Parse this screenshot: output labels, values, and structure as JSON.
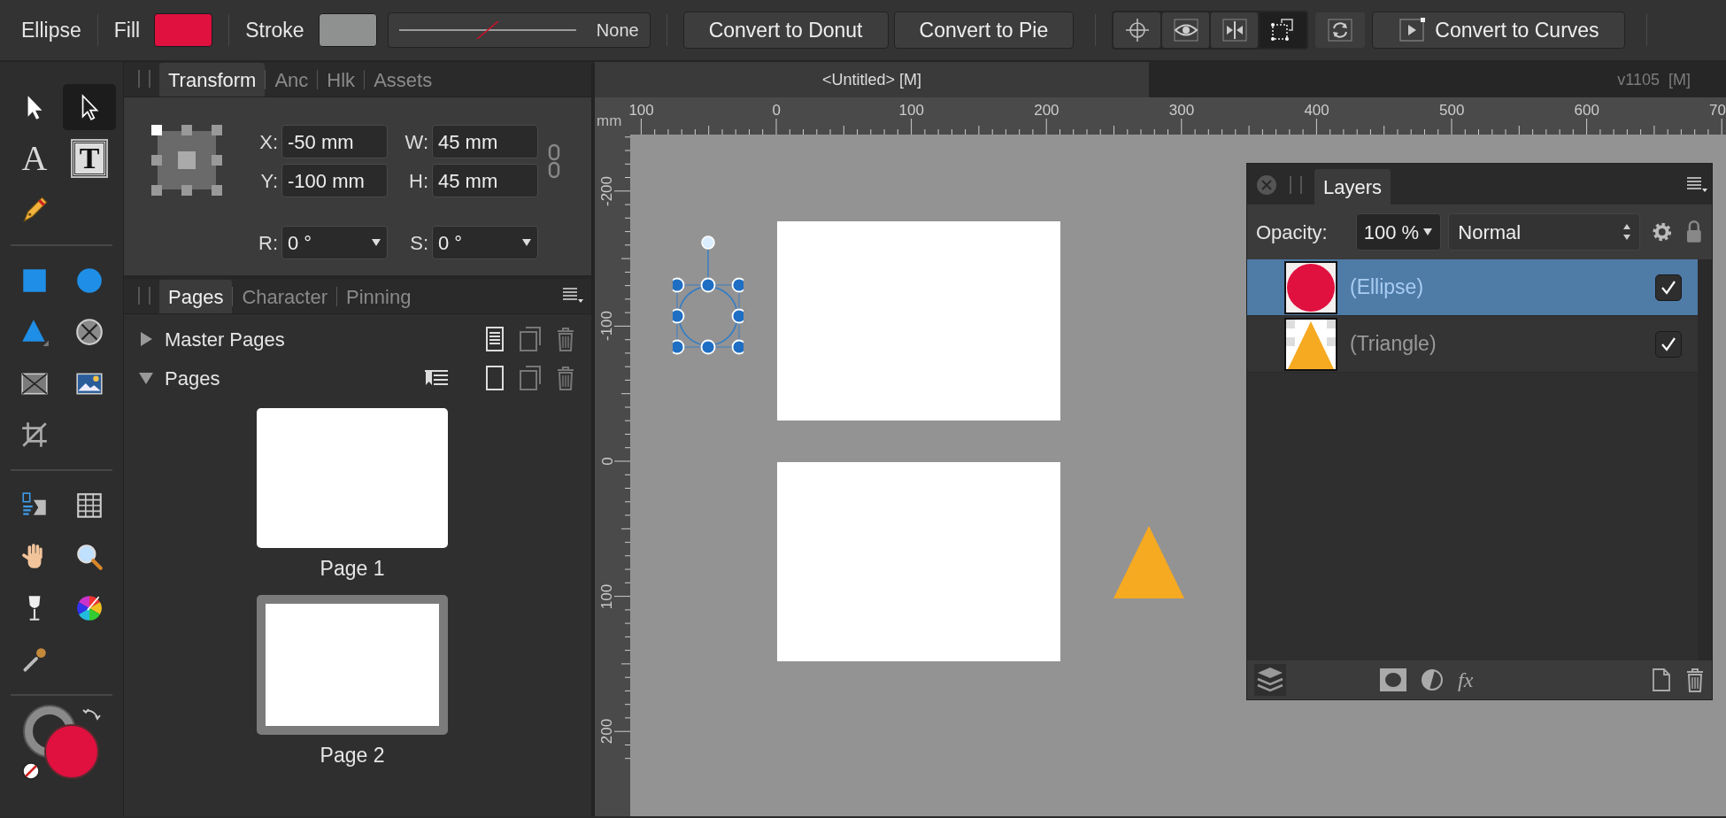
{
  "toolbar": {
    "context": "Ellipse",
    "fill": {
      "label": "Fill",
      "color": "#e0103f"
    },
    "stroke": {
      "label": "Stroke",
      "color": "#8f9191"
    },
    "stroke_width": "None",
    "buttons": [
      "Convert to Donut",
      "Convert to Pie"
    ],
    "toggles": [
      {
        "selected": false
      },
      {
        "selected": false
      },
      {
        "selected": false
      },
      {
        "selected": true
      }
    ],
    "curves_button": "Convert to Curves"
  },
  "tool_groups": [
    [
      {
        "kind": "move",
        "selected": false
      },
      {
        "kind": "node",
        "selected": true
      },
      {
        "kind": "artistic-text",
        "glyph": "A",
        "selected": false
      },
      {
        "kind": "frame-text",
        "glyph": "T",
        "selected": false
      },
      {
        "kind": "pen",
        "selected": false
      }
    ],
    [
      {
        "kind": "rectangle",
        "selected": false
      },
      {
        "kind": "ellipse",
        "selected": false
      },
      {
        "kind": "triangle",
        "selected": false
      },
      {
        "kind": "donut",
        "selected": false
      },
      {
        "kind": "frame",
        "selected": false
      },
      {
        "kind": "image",
        "selected": false
      },
      {
        "kind": "crop",
        "selected": false
      }
    ],
    [
      {
        "kind": "text-list",
        "selected": false
      },
      {
        "kind": "table",
        "selected": false
      },
      {
        "kind": "hand",
        "selected": false
      },
      {
        "kind": "zoom",
        "selected": false
      },
      {
        "kind": "glass",
        "selected": false
      },
      {
        "kind": "wheel",
        "selected": false
      },
      {
        "kind": "dropper",
        "selected": false
      }
    ]
  ],
  "color_well": {
    "color": "#e0103f"
  },
  "transform_panel": {
    "tabs": [
      {
        "label": "Transform",
        "selected": true
      },
      {
        "label": "Anc",
        "selected": false
      },
      {
        "label": "Hlk",
        "selected": false
      },
      {
        "label": "Assets",
        "selected": false
      }
    ],
    "fields": [
      {
        "label": "X:",
        "value": "-50 mm",
        "kind": "text"
      },
      {
        "label": "W:",
        "value": "45 mm",
        "kind": "text"
      },
      {
        "label": "Y:",
        "value": "-100 mm",
        "kind": "text"
      },
      {
        "label": "H:",
        "value": "45 mm",
        "kind": "text"
      },
      {
        "label": "R:",
        "value": "0 °",
        "kind": "dropdown"
      },
      {
        "label": "S:",
        "value": "0 °",
        "kind": "dropdown"
      }
    ]
  },
  "pages_panel": {
    "tabs": [
      {
        "label": "Pages",
        "selected": true
      },
      {
        "label": "Character",
        "selected": false
      },
      {
        "label": "Pinning",
        "selected": false
      }
    ],
    "sections": [
      {
        "label": "Master Pages",
        "expanded": false
      },
      {
        "label": "Pages",
        "expanded": true
      }
    ],
    "pages": [
      {
        "label": "Page 1",
        "selected": false
      },
      {
        "label": "Page 2",
        "selected": true
      }
    ]
  },
  "document_tabs": [
    {
      "title": "<Untitled> [M]",
      "selected": true
    },
    {
      "title": "v1105  [M]",
      "selected": false
    }
  ],
  "rulers": {
    "unit": "mm",
    "horizontal": [
      "100",
      "0",
      "100",
      "200",
      "300",
      "400",
      "500",
      "600",
      "70"
    ],
    "vertical": [
      "-200",
      "-100",
      "0",
      "100",
      "200"
    ]
  },
  "layers_panel": {
    "title": "Layers",
    "opacity_label": "Opacity:",
    "opacity": "100 %",
    "blend_mode": "Normal",
    "layers": [
      {
        "name": "(Ellipse)",
        "kind": "ellipse",
        "selected": true,
        "visible": true
      },
      {
        "name": "(Triangle)",
        "kind": "triangle",
        "selected": false,
        "visible": true
      }
    ],
    "footer_glyph": "fx"
  }
}
